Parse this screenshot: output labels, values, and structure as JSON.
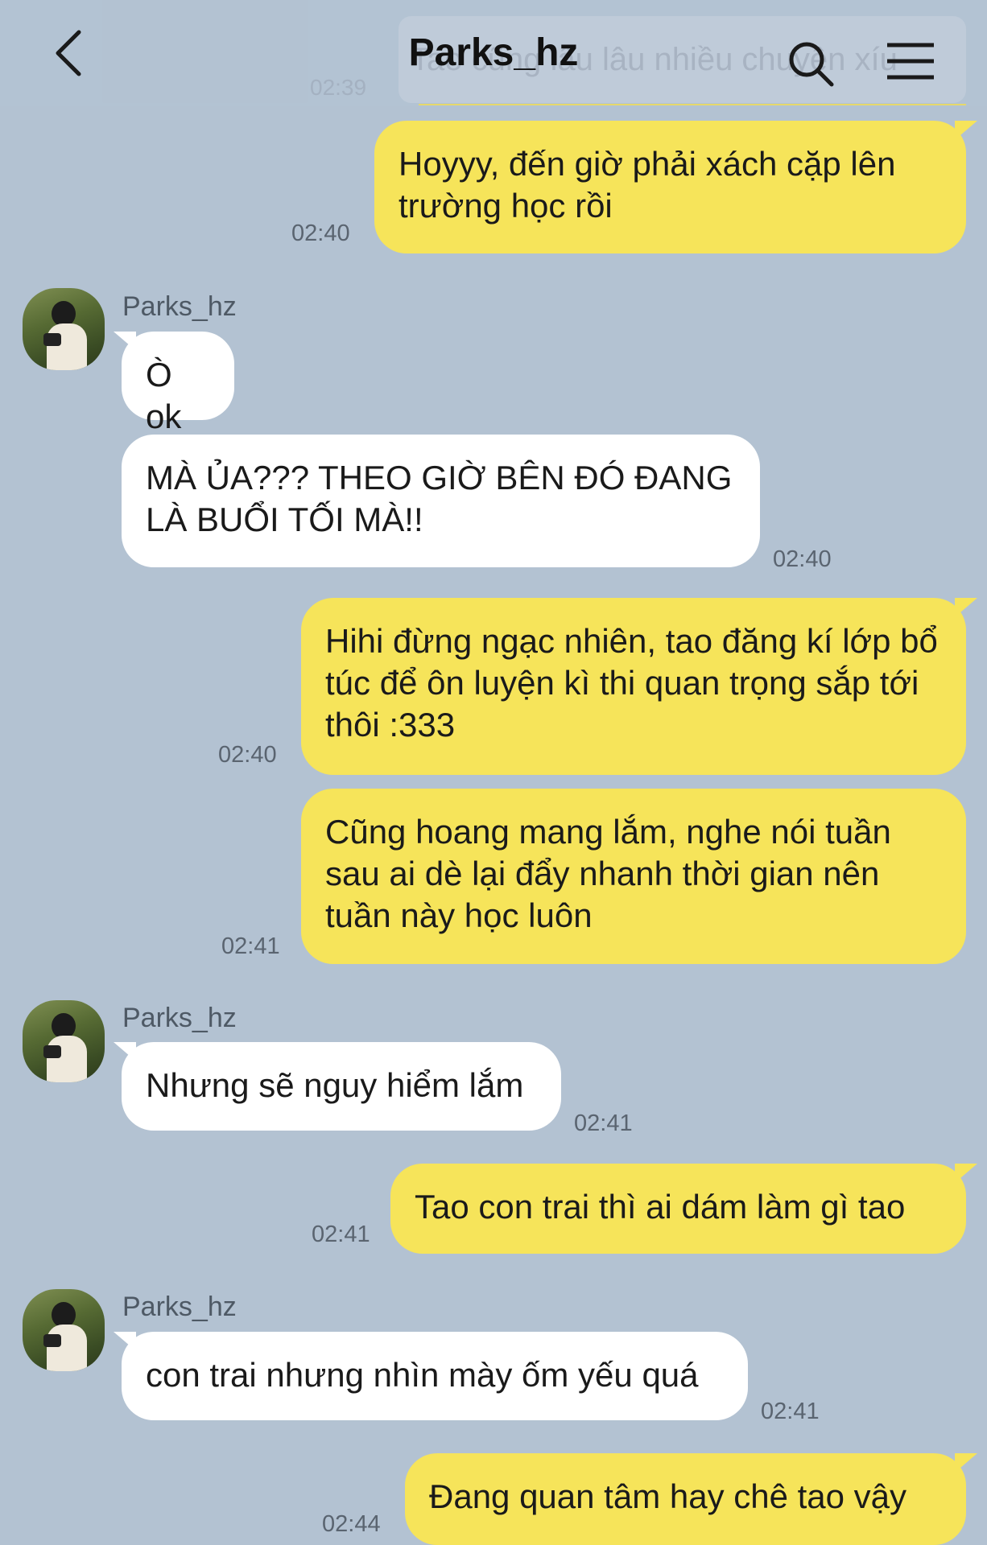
{
  "header": {
    "title": "Parks_hz",
    "back_icon": "chevron-left-icon",
    "search_icon": "search-icon",
    "menu_icon": "hamburger-menu-icon",
    "ghost_text": "Tao cũng lâu lâu nhiều chuyện xíu",
    "ghost_time": "02:39"
  },
  "contact": {
    "name": "Parks_hz"
  },
  "colors": {
    "background": "#b3c2d2",
    "my_bubble": "#f6e45a",
    "their_bubble": "#ffffff"
  },
  "messages": [
    {
      "from": "me",
      "text": "Hoyyy, đến giờ phải xách cặp lên trường học rồi",
      "time": "02:40"
    },
    {
      "from": "them",
      "sender": "Parks_hz",
      "text": "Ò ok"
    },
    {
      "from": "them",
      "text": "MÀ ỦA??? THEO GIỜ BÊN ĐÓ ĐANG LÀ BUỔI TỐI MÀ!!",
      "time": "02:40"
    },
    {
      "from": "me",
      "text": "Hihi đừng ngạc nhiên, tao đăng kí lớp bổ túc để ôn luyện kì thi quan trọng sắp tới thôi :333",
      "time": "02:40"
    },
    {
      "from": "me",
      "text": "Cũng hoang mang lắm, nghe nói tuần sau ai dè lại đẩy nhanh thời gian nên tuần này học luôn",
      "time": "02:41"
    },
    {
      "from": "them",
      "sender": "Parks_hz",
      "text": "Nhưng sẽ nguy hiểm lắm",
      "time": "02:41"
    },
    {
      "from": "me",
      "text": "Tao con trai thì ai dám làm gì tao",
      "time": "02:41"
    },
    {
      "from": "them",
      "sender": "Parks_hz",
      "text": "con trai nhưng nhìn mày ốm yếu quá",
      "time": "02:41"
    },
    {
      "from": "me",
      "text": "Đang quan tâm hay chê tao vậy",
      "time": "02:44"
    }
  ]
}
